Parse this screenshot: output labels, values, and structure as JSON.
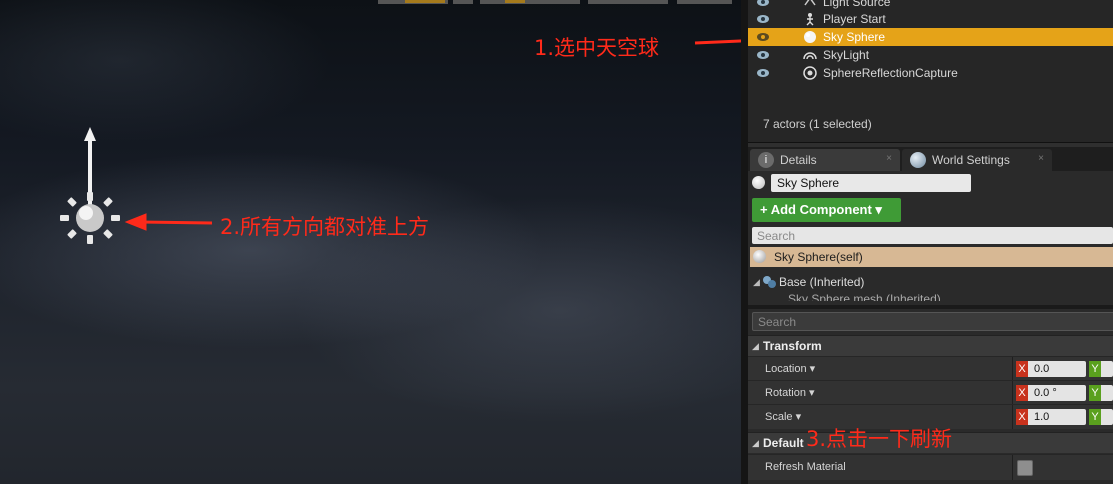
{
  "outliner": {
    "items": [
      {
        "label": "Light Source",
        "icon": "light-source-icon",
        "selected": false
      },
      {
        "label": "Player Start",
        "icon": "player-start-icon",
        "selected": false
      },
      {
        "label": "Sky Sphere",
        "icon": "sphere-icon",
        "selected": true
      },
      {
        "label": "SkyLight",
        "icon": "skylight-icon",
        "selected": false
      },
      {
        "label": "SphereReflectionCapture",
        "icon": "reflection-capture-icon",
        "selected": false
      }
    ],
    "actor_count": "7 actors (1 selected)"
  },
  "tabs": {
    "details": "Details",
    "world_settings": "World Settings",
    "close_glyph": "×"
  },
  "details": {
    "name": "Sky Sphere",
    "add_component": "+ Add Component ▾",
    "search_placeholder": "Search",
    "self": "Sky Sphere(self)",
    "base": "Base (Inherited)",
    "mesh": "Sky Sphere mesh (Inherited)",
    "search2_placeholder": "Search",
    "transform": "Transform",
    "location_label": "Location ▾",
    "location_x": "0.0",
    "rotation_label": "Rotation ▾",
    "rotation_x": "0.0 °",
    "scale_label": "Scale ▾",
    "scale_x": "1.0",
    "default": "Default",
    "refresh_material": "Refresh Material"
  },
  "annotations": {
    "a1": "1.选中天空球",
    "a2": "2.所有方向都对准上方",
    "a3": "3.点击一下刷新"
  },
  "colors": {
    "selected": "#e5a318",
    "annotation": "#ff2a1a",
    "add_button": "#3f9b36",
    "axis_x": "#c8321d",
    "axis_y": "#5aa01e"
  }
}
